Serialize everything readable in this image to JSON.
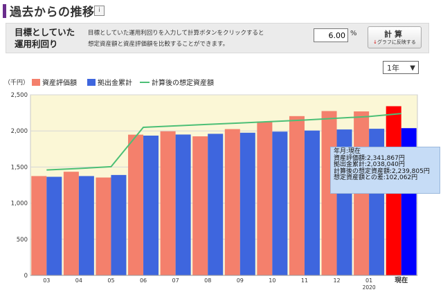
{
  "header": {
    "title": "過去からの推移",
    "info_icon": "info-icon"
  },
  "panel": {
    "label_line1": "目標としていた",
    "label_line2": "運用利回り",
    "desc_line1": "目標としていた運用利回りを入力して計算ボタンをクリックすると",
    "desc_line2": "想定資産額と資産評価額を比較することができます。",
    "rate_value": "6.00",
    "rate_unit": "%",
    "calc_button_label": "計算",
    "calc_button_sub": "グラフに反映する"
  },
  "period": {
    "selected": "1年"
  },
  "chart_data": {
    "type": "bar",
    "unit_label": "（千円）",
    "categories": [
      "03",
      "04",
      "05",
      "06",
      "07",
      "08",
      "09",
      "10",
      "11",
      "12",
      "01",
      "現在"
    ],
    "year_label": "2020",
    "series": [
      {
        "name": "資産評価額",
        "kind": "bar",
        "color": "#f4806c",
        "current_color": "#ff0000",
        "values": [
          1375,
          1435,
          1355,
          1948,
          1995,
          1925,
          2025,
          2130,
          2205,
          2275,
          2270,
          2342
        ]
      },
      {
        "name": "拠出金累計",
        "kind": "bar",
        "color": "#3e66de",
        "current_color": "#0000ff",
        "values": [
          1365,
          1375,
          1390,
          1935,
          1950,
          1960,
          1975,
          1990,
          2005,
          2020,
          2030,
          2038
        ]
      },
      {
        "name": "計算後の想定資産額",
        "kind": "line",
        "color": "#4cbf76",
        "values": [
          1460,
          1480,
          1505,
          2050,
          2070,
          2090,
          2110,
          2130,
          2150,
          2175,
          2200,
          2240
        ]
      }
    ],
    "ylim": [
      0,
      2500
    ],
    "yticks": [
      0,
      500,
      1000,
      1500,
      2000,
      2500
    ],
    "ytick_labels": [
      "0",
      "500",
      "1,000",
      "1,500",
      "2,000",
      "2,500"
    ],
    "grid": true
  },
  "tooltip": {
    "line1": "年月:現在",
    "line2": "資産評価額:2,341,867円",
    "line3": "拠出金累計:2,038,040円",
    "line4": "計算後の想定資産額:2,239,805円",
    "line5": "想定資産額との差:102,062円"
  }
}
